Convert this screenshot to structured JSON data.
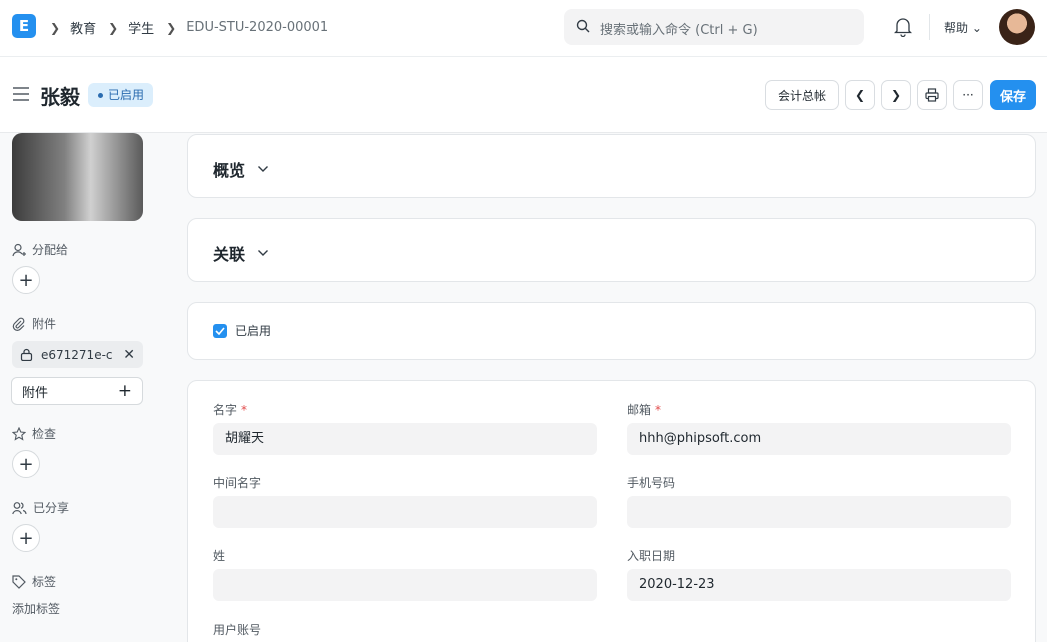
{
  "navbar": {
    "logo_letter": "E",
    "breadcrumbs": [
      "教育",
      "学生",
      "EDU-STU-2020-00001"
    ],
    "search_placeholder": "搜索或输入命令 (Ctrl + G)",
    "help_label": "帮助"
  },
  "header": {
    "title": "张毅",
    "status_badge": "已启用",
    "accounting_button": "会计总帐",
    "save_button": "保存",
    "more_glyph": "···"
  },
  "sidebar": {
    "assign_label": "分配给",
    "attachments_label": "附件",
    "attachment_file": "e671271e-c",
    "attach_button": "附件",
    "review_label": "检查",
    "shared_label": "已分享",
    "tags_label": "标签",
    "add_tag": "添加标签"
  },
  "sections": {
    "overview": "概览",
    "connections": "关联",
    "enabled_checkbox": "已启用"
  },
  "form": {
    "first_name_label": "名字",
    "first_name_value": "胡耀天",
    "email_label": "邮箱",
    "email_value": "hhh@phipsoft.com",
    "middle_name_label": "中间名字",
    "middle_name_value": "",
    "mobile_label": "手机号码",
    "mobile_value": "",
    "last_name_label": "姓",
    "last_name_value": "",
    "joining_date_label": "入职日期",
    "joining_date_value": "2020-12-23",
    "user_account_label": "用户账号",
    "required_mark": "*"
  },
  "colors": {
    "primary": "#2490ef",
    "badge_bg": "#dbeefc",
    "required": "#e24c4c"
  }
}
